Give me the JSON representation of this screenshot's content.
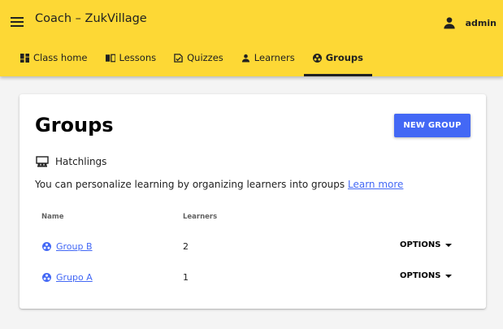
{
  "app": {
    "title": "Coach – ZukVillage",
    "user": "admin"
  },
  "tabs": [
    {
      "label": "Class home",
      "icon": "dashboard-icon"
    },
    {
      "label": "Lessons",
      "icon": "book-icon"
    },
    {
      "label": "Quizzes",
      "icon": "quiz-icon"
    },
    {
      "label": "Learners",
      "icon": "person-icon"
    },
    {
      "label": "Groups",
      "icon": "group-icon",
      "active": true
    }
  ],
  "page": {
    "title": "Groups",
    "new_group_label": "NEW GROUP",
    "class_name": "Hatchlings",
    "description": "You can personalize learning by organizing learners into groups",
    "learn_more": "Learn more"
  },
  "table": {
    "headers": [
      "Name",
      "Learners"
    ],
    "rows": [
      {
        "name": "Group B",
        "learners": "2",
        "options": "OPTIONS"
      },
      {
        "name": "Grupo A",
        "learners": "1",
        "options": "OPTIONS"
      }
    ]
  },
  "colors": {
    "appbar": "#fdd835",
    "accent": "#4368f5"
  }
}
